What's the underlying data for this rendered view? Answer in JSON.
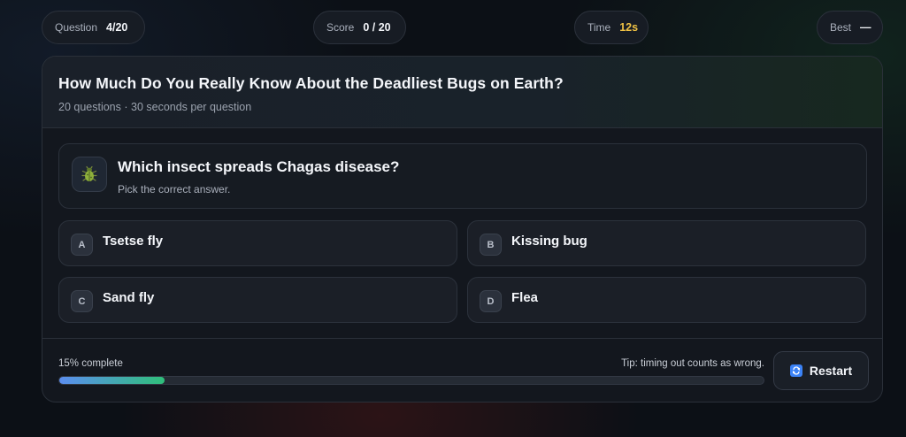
{
  "stats": {
    "question": {
      "label": "Question",
      "value": "4/20"
    },
    "score": {
      "label": "Score",
      "value": "0 / 20"
    },
    "time": {
      "label": "Time",
      "value": "12s"
    },
    "best": {
      "label": "Best",
      "value": "—"
    }
  },
  "quiz": {
    "title": "How Much Do You Really Know About the Deadliest Bugs on Earth?",
    "subtitle": "20 questions · 30 seconds per question"
  },
  "question": {
    "icon": "beetle-icon",
    "text": "Which insect spreads Chagas disease?",
    "hint": "Pick the correct answer."
  },
  "options": [
    {
      "letter": "A",
      "text": "Tsetse fly"
    },
    {
      "letter": "B",
      "text": "Kissing bug"
    },
    {
      "letter": "C",
      "text": "Sand fly"
    },
    {
      "letter": "D",
      "text": "Flea"
    }
  ],
  "footer": {
    "progress_label": "15% complete",
    "progress_fraction": 0.15,
    "tip": "Tip: timing out counts as wrong.",
    "restart_label": "Restart",
    "restart_icon": "restart-icon"
  },
  "colors": {
    "time_accent": "#f0c244",
    "progress_start": "#5b8ef0",
    "progress_end": "#2fbf7a",
    "restart_icon_bg": "#3b82f6"
  }
}
